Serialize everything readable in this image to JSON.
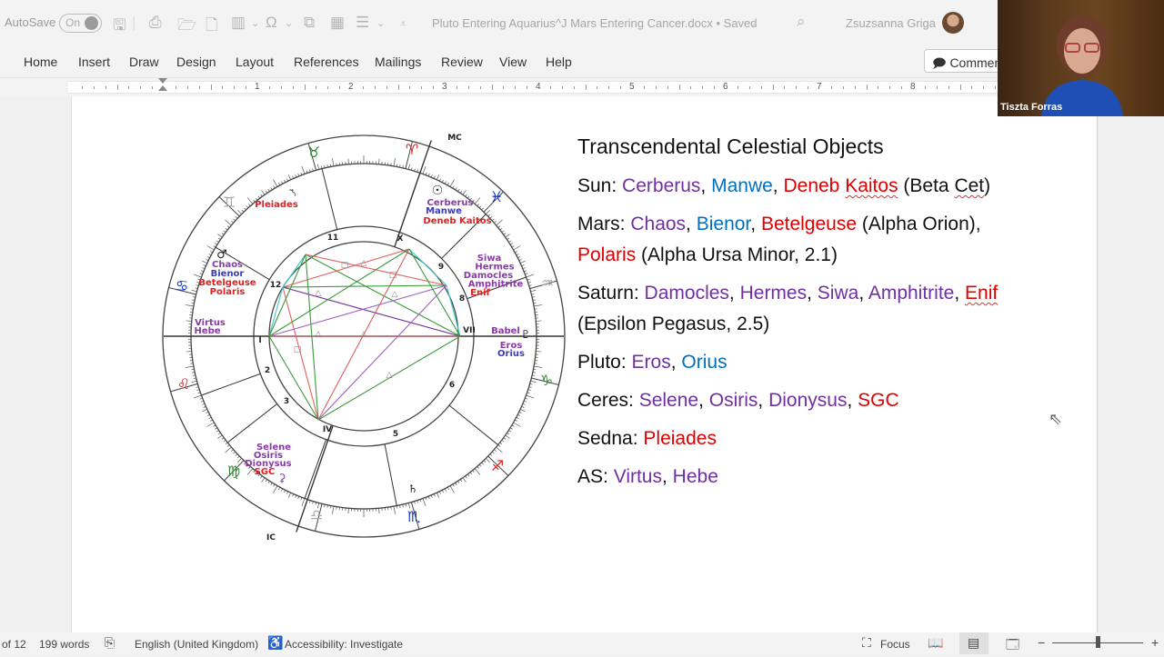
{
  "titlebar": {
    "autosave_label": "AutoSave",
    "autosave_state": "On",
    "document_title": "Pluto Entering Aquarius^J Mars Entering Cancer.docx • Saved",
    "title_chevron": "⌄",
    "user_name": "Zsuzsanna Griga",
    "quick_access_icons": [
      "save-icon",
      "print-preview-icon",
      "open-folder-icon",
      "new-document-icon",
      "columns-icon",
      "symbol-omega-icon",
      "translate-icon",
      "draw-table-icon",
      "line-spacing-icon",
      "customize-icon"
    ]
  },
  "ribbon": {
    "tabs": [
      "Home",
      "Insert",
      "Draw",
      "Design",
      "Layout",
      "References",
      "Mailings",
      "Review",
      "View",
      "Help"
    ],
    "comments_label": "Comments"
  },
  "ruler": {
    "numbers": [
      "1",
      "2",
      "3",
      "4",
      "5",
      "6",
      "7",
      "8"
    ]
  },
  "video": {
    "participant_name": "Tiszta Forras"
  },
  "chart": {
    "angles": {
      "mc": "MC",
      "ic": "IC"
    },
    "houses": [
      "I",
      "2",
      "3",
      "IV",
      "5",
      "6",
      "VII",
      "8",
      "9",
      "X",
      "11",
      "12"
    ],
    "labels": {
      "pleiades": "Pleiades",
      "mars_group": [
        "Chaos",
        "Bienor",
        "Betelgeuse",
        "Polaris"
      ],
      "as_group": [
        "Virtus",
        "Hebe"
      ],
      "sun_group": [
        "Cerberus",
        "Manwe",
        "Deneb Kaitos"
      ],
      "saturn_group": [
        "Siwa",
        "Hermes",
        "Damocles",
        "Amphitrite",
        "Enif"
      ],
      "pluto_group": [
        "Babel",
        "Eros",
        "Orius"
      ],
      "ceres_group": [
        "Selene",
        "Osiris",
        "Dionysus",
        "SGC"
      ]
    },
    "signs": {
      "aries": "♈",
      "taurus": "♉",
      "gemini": "♊",
      "cancer": "♋",
      "leo": "♌",
      "virgo": "♍",
      "libra": "♎",
      "scorpio": "♏",
      "sagittarius": "♐",
      "capricorn": "♑",
      "aquarius": "♒",
      "pisces": "♓"
    },
    "planets": {
      "sun": "☉",
      "mars": "♂",
      "saturn": "♄",
      "pluto": "♇",
      "sedna": "⯲",
      "ceres": "⚳"
    }
  },
  "content": {
    "title": "Transcendental Celestial Objects",
    "sun": {
      "label": "Sun: ",
      "a": "Cerberus",
      "b": "Manwe",
      "c": "Deneb",
      "c2": "Kaitos",
      "tail": " (Beta ",
      "tail2": "Cet",
      ")": ")"
    },
    "mars": {
      "label": "Mars: ",
      "a": "Chaos",
      "b": "Bienor",
      "c": "Betelgeuse",
      "mid": " (Alpha Orion), ",
      "d": "Polaris",
      "tail": " (Alpha Ursa Minor, 2.1)"
    },
    "saturn": {
      "label": "Saturn: ",
      "a": "Damocles",
      "b": "Hermes",
      "c": "Siwa",
      "d": "Amphitrite",
      "e": "Enif",
      "tail": " (Epsilon Pegasus, 2.5)"
    },
    "pluto": {
      "label": "Pluto: ",
      "a": "Eros",
      "b": "Orius"
    },
    "ceres": {
      "label": "Ceres: ",
      "a": "Selene",
      "b": "Osiris",
      "c": "Dionysus",
      "d": "SGC"
    },
    "sedna": {
      "label": "Sedna: ",
      "a": "Pleiades"
    },
    "as": {
      "label": "AS: ",
      "a": "Virtus",
      "b": "Hebe"
    },
    "sep": ", "
  },
  "statusbar": {
    "page": "of 12",
    "words": "199 words",
    "language": "English (United Kingdom)",
    "accessibility": "Accessibility: Investigate",
    "focus": "Focus",
    "zoom_minus": "−",
    "zoom_plus": "+"
  },
  "colors": {
    "purple": "#7030a0",
    "blue": "#0070c0",
    "red": "#e00000"
  }
}
